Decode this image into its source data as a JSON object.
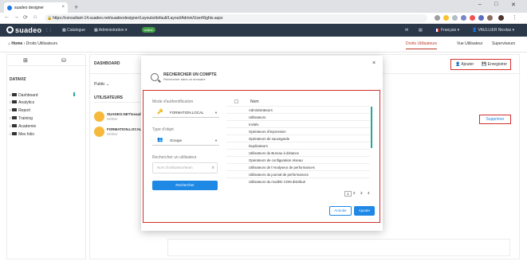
{
  "browser": {
    "tab_title": "suadeo designer",
    "new_tab": "+",
    "url": "https://consultant-14.suadeo.net/suadeodesigner/Layouts/default/Layout/Admin/UserRights.aspx"
  },
  "topbar": {
    "logo": "suadeo",
    "catalogue": "Catalogue",
    "administration": "Administration",
    "online_badge": "online",
    "language": "Français",
    "user": "VAULLIER Nicolas"
  },
  "subbar": {
    "home": "Home",
    "separator": "›",
    "page": "Droits Utilisateurs",
    "tabs": [
      {
        "label": "Droits Utilisateurs",
        "active": true
      },
      {
        "label": "Vue Utilisateur",
        "active": false
      },
      {
        "label": "Superviseurs",
        "active": false
      }
    ]
  },
  "sidebar": {
    "title": "DATAVIZ",
    "items": [
      {
        "label": "Dashboard"
      },
      {
        "label": "Analytics"
      },
      {
        "label": "Report"
      },
      {
        "label": "Training"
      },
      {
        "label": "Academie"
      },
      {
        "label": "Mes folio"
      }
    ]
  },
  "main": {
    "header": "DASHBOARD",
    "ajouter": "Ajouter",
    "enregistrer": "Enregistrer",
    "public_label": "Public",
    "utilisateurs_title": "UTILISATEURS",
    "users": [
      {
        "name": "SUADEO.NET\\nvaullie...",
        "status": "Hériter"
      },
      {
        "name": "FORMATION.LOCAL\\...",
        "status": "Hériter"
      }
    ],
    "supprimer": "Supprimer"
  },
  "modal": {
    "title": "RECHERCHER UN COMPTE",
    "subtitle": "Rechercher dans un annuaire",
    "close": "×",
    "auth_label": "Mode d'authentification",
    "auth_value": "FORMATION.LOCAL",
    "type_label": "Type d'objet",
    "type_value": "Groupe",
    "search_label": "Rechercher un utilisateur",
    "search_placeholder": "Nom d'utilisateur/team",
    "search_button": "Rechercher",
    "list_header": "Nom",
    "rows": [
      "Administrateurs",
      "Utilisateurs",
      "Invités",
      "Opérateurs d'impression",
      "Opérateurs de sauvegarde",
      "Duplicateurs",
      "Utilisateurs du Bureau à distance",
      "Opérateurs de configuration réseau",
      "Utilisateurs de l'Analyseur de performances",
      "Utilisateurs du journal de performances",
      "Utilisateurs du modèle COM distribué"
    ],
    "pages": [
      "1",
      "2",
      "3",
      "4"
    ],
    "cancel": "Annuler",
    "add": "Ajouter"
  },
  "colors": {
    "topbar": "#2b3849",
    "accent_red": "#d32f2f",
    "primary_blue": "#1e88e5",
    "avatar": "#f6b93b"
  }
}
